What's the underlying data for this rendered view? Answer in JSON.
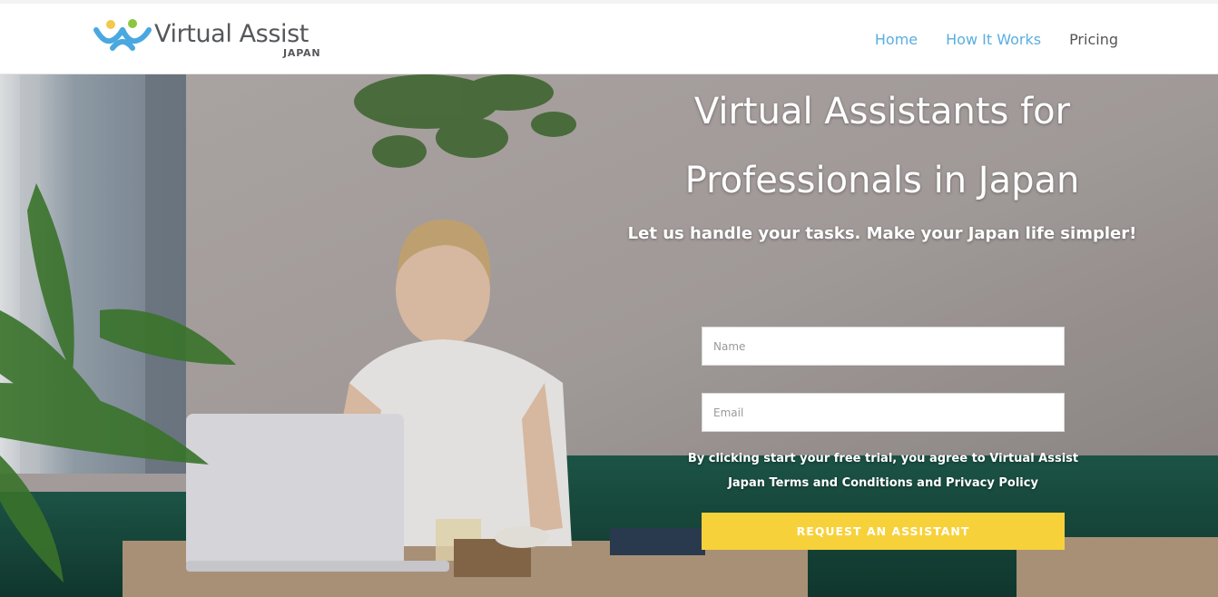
{
  "header": {
    "logo_text": "Virtual Assist",
    "logo_sub": "JAPAN",
    "nav": [
      {
        "label": "Home"
      },
      {
        "label": "How It Works"
      },
      {
        "label": "Pricing"
      }
    ]
  },
  "hero": {
    "title_line1": "Virtual Assistants for",
    "title_line2": "Professionals in Japan",
    "subtitle": "Let us handle your tasks. Make your Japan life simpler!",
    "form": {
      "name_placeholder": "Name",
      "email_placeholder": "Email",
      "agreement_line1": "By clicking start your free trial, you agree to Virtual Assist",
      "agreement_line2": "Japan Terms and Conditions and Privacy Policy",
      "submit_label": "REQUEST AN ASSISTANT"
    }
  },
  "colors": {
    "nav_active": "#5aaee0",
    "nav_plain": "#555555",
    "cta_background": "#f7d13a",
    "logo_blue": "#4aa8e0",
    "logo_yellow": "#f2c94c",
    "logo_green": "#8cc63f"
  }
}
